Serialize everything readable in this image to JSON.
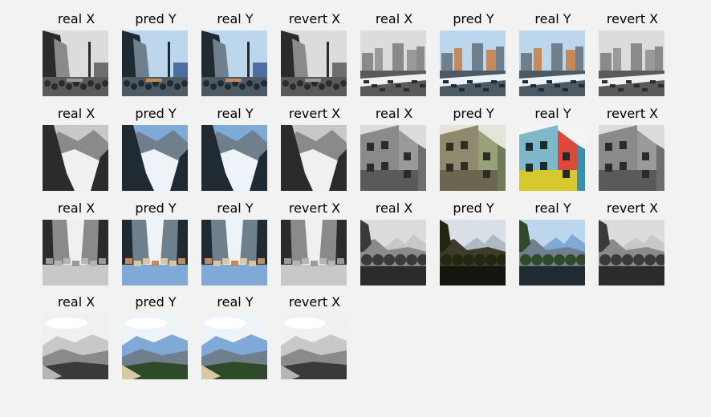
{
  "colors": {
    "background": "#f2f2f2",
    "text": "#000000"
  },
  "rows": [
    {
      "cells": [
        {
          "label": "real X",
          "scene": "city-street",
          "tone": "gray"
        },
        {
          "label": "pred Y",
          "scene": "city-street",
          "tone": "color"
        },
        {
          "label": "real Y",
          "scene": "city-street",
          "tone": "color"
        },
        {
          "label": "revert X",
          "scene": "city-street",
          "tone": "gray"
        },
        {
          "label": "real X",
          "scene": "skyline-road",
          "tone": "gray"
        },
        {
          "label": "pred Y",
          "scene": "skyline-road",
          "tone": "color"
        },
        {
          "label": "real Y",
          "scene": "skyline-road",
          "tone": "color"
        },
        {
          "label": "revert X",
          "scene": "skyline-road",
          "tone": "gray"
        }
      ]
    },
    {
      "cells": [
        {
          "label": "real X",
          "scene": "glacier",
          "tone": "gray"
        },
        {
          "label": "pred Y",
          "scene": "glacier",
          "tone": "color"
        },
        {
          "label": "real Y",
          "scene": "glacier",
          "tone": "color"
        },
        {
          "label": "revert X",
          "scene": "glacier",
          "tone": "gray"
        },
        {
          "label": "real X",
          "scene": "houses",
          "tone": "gray"
        },
        {
          "label": "pred Y",
          "scene": "houses",
          "tone": "muted"
        },
        {
          "label": "real Y",
          "scene": "houses",
          "tone": "vivid"
        },
        {
          "label": "revert X",
          "scene": "houses",
          "tone": "gray"
        }
      ]
    },
    {
      "cells": [
        {
          "label": "real X",
          "scene": "avenue",
          "tone": "gray"
        },
        {
          "label": "pred Y",
          "scene": "avenue",
          "tone": "color"
        },
        {
          "label": "real Y",
          "scene": "avenue",
          "tone": "color"
        },
        {
          "label": "revert X",
          "scene": "avenue",
          "tone": "gray"
        },
        {
          "label": "real X",
          "scene": "dark-hills",
          "tone": "gray"
        },
        {
          "label": "pred Y",
          "scene": "dark-hills",
          "tone": "warm"
        },
        {
          "label": "real Y",
          "scene": "dark-hills",
          "tone": "color"
        },
        {
          "label": "revert X",
          "scene": "dark-hills",
          "tone": "gray"
        }
      ]
    },
    {
      "cells": [
        {
          "label": "real X",
          "scene": "mountains",
          "tone": "gray"
        },
        {
          "label": "pred Y",
          "scene": "mountains",
          "tone": "color"
        },
        {
          "label": "real Y",
          "scene": "mountains",
          "tone": "color"
        },
        {
          "label": "revert X",
          "scene": "mountains",
          "tone": "gray"
        }
      ]
    }
  ]
}
